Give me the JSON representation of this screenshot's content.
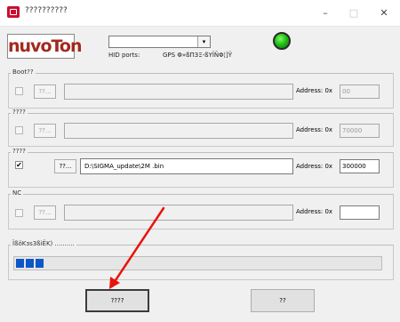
{
  "window": {
    "title": "??????????",
    "minimize_glyph": "–",
    "maximize_glyph": "□",
    "close_glyph": "✕"
  },
  "logo": {
    "text": "nuvoTon"
  },
  "device": {
    "hid_label": "HID ports:",
    "hid_value": "GPS Φ»ßΠ3Ξ-ßΥÏÑΦ¦]Ÿ",
    "combo_value": "",
    "combo_arrow": "▾",
    "led_color": "#22c01a"
  },
  "rows": [
    {
      "title": "Boot??",
      "checked": false,
      "enabled": false,
      "browse_label": "??...",
      "path": "",
      "address_label": "Address: 0x",
      "address": "00"
    },
    {
      "title": "????",
      "checked": false,
      "enabled": false,
      "browse_label": "??...",
      "path": "",
      "address_label": "Address: 0x",
      "address": "70000"
    },
    {
      "title": "????",
      "checked": true,
      "enabled": true,
      "browse_label": "??...",
      "path": "D:\\SIGMA_update\\2M .bin",
      "address_label": "Address: 0x",
      "address": "300000"
    },
    {
      "title": "NC",
      "checked": false,
      "enabled": false,
      "browse_label": "??...",
      "path": "",
      "address_label": "Address: 0x",
      "address": ""
    }
  ],
  "progress": {
    "label": "ÏßöKɜs3ßiËK) ..........",
    "fraction": 0.07,
    "block_color": "#0b57c7"
  },
  "buttons": {
    "primary_label": "????",
    "secondary_label": "??"
  },
  "annotation": {
    "arrow_color": "#e8140c"
  }
}
